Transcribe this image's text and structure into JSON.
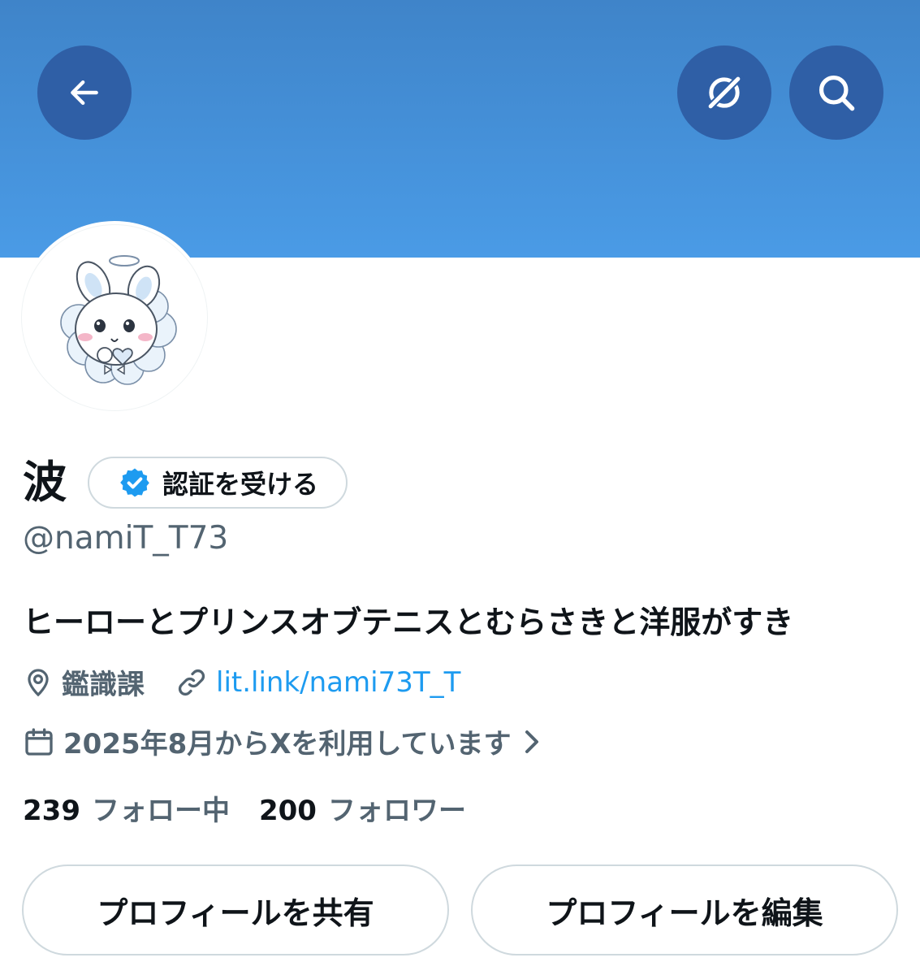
{
  "header": {
    "back_icon": "arrow-left-icon",
    "grok_icon": "grok-icon",
    "search_icon": "search-icon",
    "banner_color": "#4a9be6",
    "button_color": "#2f5fa6"
  },
  "profile": {
    "avatar": "bunny-illustration",
    "display_name": "波",
    "verify_label": "認証を受ける",
    "verify_icon": "verified-badge-icon",
    "handle": "@namiT_T73",
    "bio": "ヒーローとプリンスオブテニスとむらさきと洋服がすき",
    "location": "鑑識課",
    "location_icon": "location-pin-icon",
    "link": "lit.link/nami73T_T",
    "link_icon": "link-icon",
    "joined": "2025年8月からXを利用しています",
    "joined_icon": "calendar-icon"
  },
  "stats": {
    "following_count": "239",
    "following_label": "フォロー中",
    "followers_count": "200",
    "followers_label": "フォロワー"
  },
  "actions": {
    "share_label": "プロフィールを共有",
    "edit_label": "プロフィールを編集"
  },
  "colors": {
    "link": "#1d9bf0",
    "secondary_text": "#536471",
    "verified": "#1d9bf0"
  }
}
